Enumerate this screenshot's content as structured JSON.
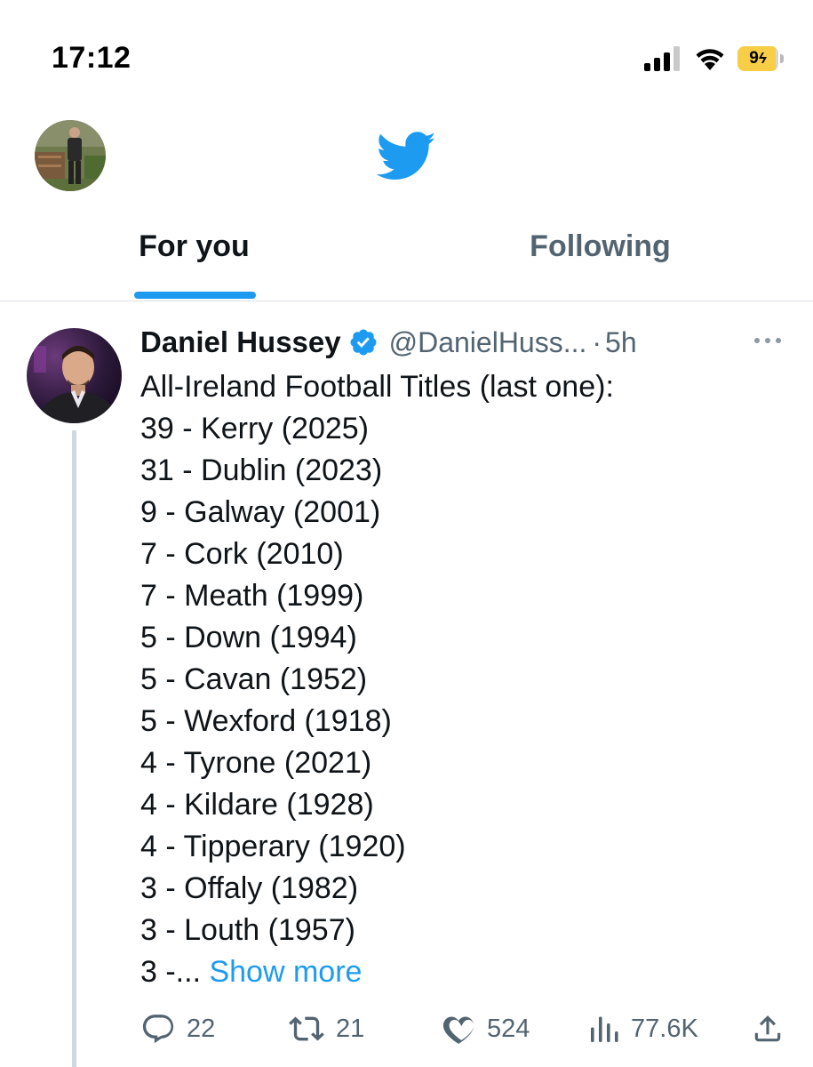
{
  "status_bar": {
    "time": "17:12",
    "battery_level": "94",
    "battery_fill_percent": 94,
    "battery_charging": true,
    "battery_color": "#f7ce46",
    "icons": [
      "signal-icon",
      "wifi-icon",
      "battery-icon"
    ]
  },
  "top_bar": {
    "logo": "twitter-bird-icon",
    "logo_color": "#1d9bf0"
  },
  "tabs": [
    {
      "label": "For you",
      "active": true
    },
    {
      "label": "Following",
      "active": false
    }
  ],
  "tweet": {
    "author_name": "Daniel Hussey",
    "verified": true,
    "handle": "@DanielHuss...",
    "separator": "·",
    "time": "5h",
    "lines": [
      "All-Ireland Football Titles (last one):",
      "39 - Kerry (2025)",
      "31 - Dublin (2023)",
      "9 - Galway (2001)",
      "7 - Cork (2010)",
      "7 - Meath (1999)",
      "5 - Down (1994)",
      "5 - Cavan (1952)",
      "5 - Wexford (1918)",
      "4 - Tyrone (2021)",
      "4 - Kildare (1928)",
      "4 - Tipperary (1920)",
      "3 - Offaly (1982)",
      "3 - Louth (1957)"
    ],
    "truncated_line": "3 -... ",
    "show_more": "Show more",
    "actions": {
      "replies": "22",
      "retweets": "21",
      "likes": "524",
      "views": "77.6K"
    }
  },
  "colors": {
    "accent": "#1d9bf0",
    "secondary_text": "#536471",
    "divider": "#dbe1e6"
  }
}
